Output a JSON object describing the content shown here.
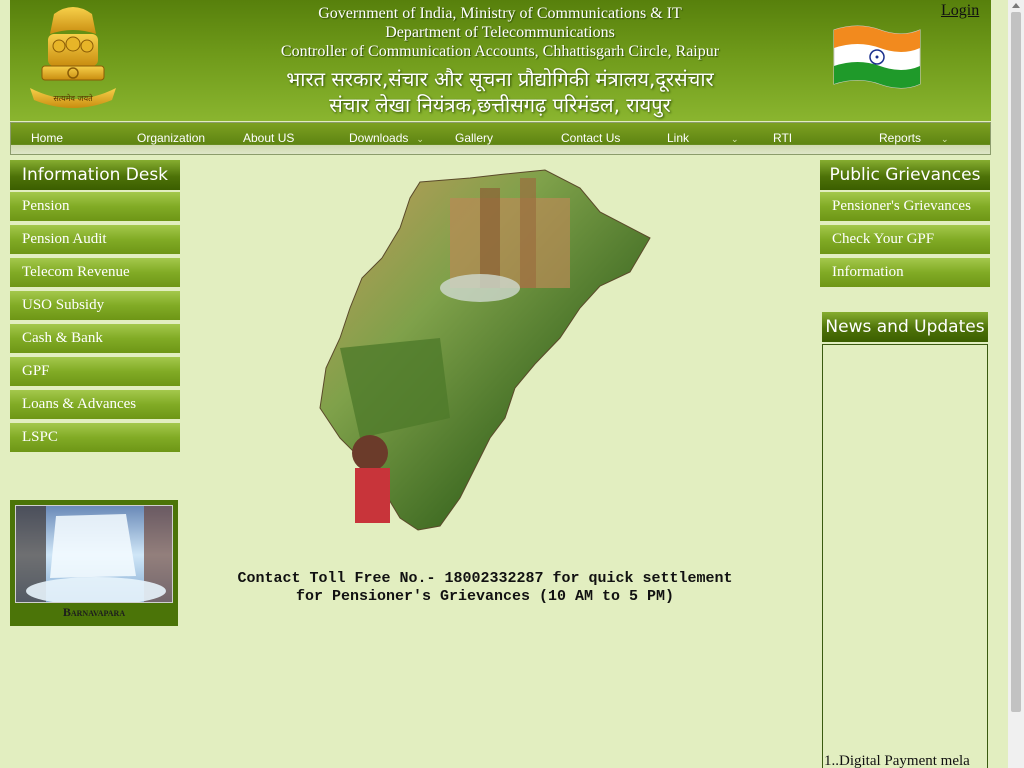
{
  "header": {
    "line1_en": "Government of India, Ministry of Communications & IT",
    "line2_en": "Department of Telecommunications",
    "line3_en": "Controller of Communication Accounts, Chhattisgarh Circle, Raipur",
    "line1_hi": "भारत सरकार,संचार और सूचना प्रौद्योगिकी मंत्रालय,दूरसंचार",
    "line2_hi": "संचार लेखा नियंत्रक,छत्तीसगढ़ परिमंडल, रायपुर",
    "emblem_motto": "सत्यमेव जयते",
    "login_label": "Login"
  },
  "nav": {
    "items": [
      {
        "label": "Home",
        "dropdown": false
      },
      {
        "label": "Organization",
        "dropdown": false
      },
      {
        "label": "About US",
        "dropdown": false
      },
      {
        "label": "Downloads",
        "dropdown": true
      },
      {
        "label": "Gallery",
        "dropdown": false
      },
      {
        "label": "Contact Us",
        "dropdown": false
      },
      {
        "label": "Link",
        "dropdown": true
      },
      {
        "label": "RTI",
        "dropdown": false
      },
      {
        "label": "Reports",
        "dropdown": true
      }
    ],
    "chevron_icon": "chevron-down-icon"
  },
  "info_desk": {
    "title": "Information Desk",
    "items": [
      "Pension",
      "Pension Audit",
      "Telecom Revenue",
      "USO Subsidy",
      "Cash & Bank",
      "GPF",
      "Loans & Advances",
      "LSPC"
    ]
  },
  "gallery": {
    "caption": "Barnavapara"
  },
  "public_grievances": {
    "title": "Public Grievances",
    "items": [
      "Pensioner's Grievances",
      "Check Your GPF",
      "Information"
    ]
  },
  "news": {
    "title": "News and Updates",
    "items": [
      "1..Digital Payment mela"
    ]
  },
  "contact": {
    "line1": "Contact Toll Free No.- 18002332287 for quick settlement",
    "line2": "for Pensioner's Grievances (10 AM to 5 PM)"
  },
  "colors": {
    "page_bg": "#e2eec0",
    "header_green": "#6f9a1a",
    "menu_green": "#81ab25",
    "title_green": "#4d7208"
  }
}
